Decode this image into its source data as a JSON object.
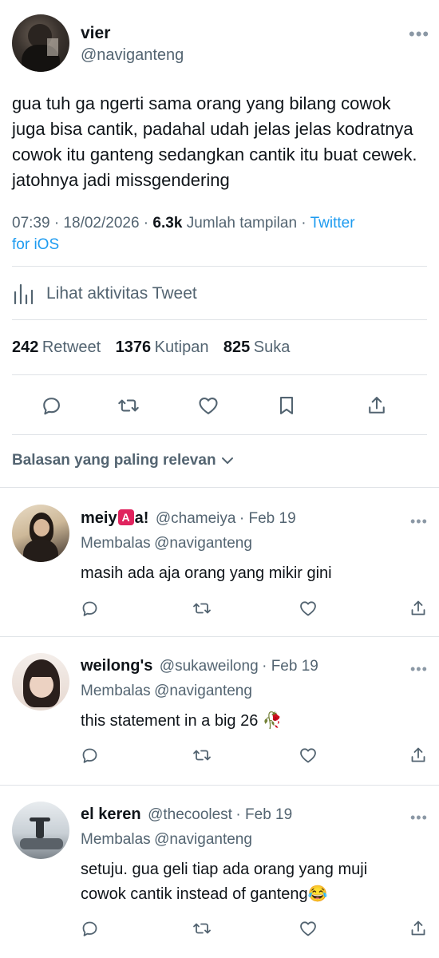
{
  "main_tweet": {
    "display_name": "vier",
    "handle": "@naviganteng",
    "more_label": "•••",
    "text": "gua tuh ga ngerti sama orang yang bilang cowok juga bisa cantik, padahal udah jelas jelas kodratnya cowok itu ganteng sedangkan cantik itu buat cewek. jatohnya jadi missgendering",
    "time": "07:39 · 18/02/2026 · ",
    "views_count": "6.3k",
    "views_label": "Jumlah tampilan",
    "separator": " · ",
    "source": "Twitter",
    "source_line2": "for iOS",
    "activity_label": "Lihat aktivitas Tweet",
    "stats": {
      "retweets": "242",
      "retweets_label": "Retweet",
      "quotes": "1376",
      "quotes_label": "Kutipan",
      "likes": "825",
      "likes_label": "Suka"
    }
  },
  "sort": {
    "label": "Balasan yang paling relevan"
  },
  "replies": [
    {
      "display_name_a": "meiy",
      "badge": "A",
      "display_name_b": "a!",
      "handle": "@chameiya",
      "date": "· Feb 19",
      "reply_prefix": "Membalas",
      "reply_to": "@naviganteng",
      "text": "masih ada aja orang yang mikir gini",
      "more_label": "•••"
    },
    {
      "display_name": "weilong's",
      "handle": "@sukaweilong",
      "date": "· Feb 19",
      "reply_prefix": "Membalas",
      "reply_to": "@naviganteng",
      "text": "this statement in a big 26 🥀",
      "more_label": "•••"
    },
    {
      "display_name": "el keren",
      "handle": "@thecoolest",
      "date": "· Feb 19",
      "reply_prefix": "Membalas",
      "reply_to": "@naviganteng",
      "text_line1": "setuju. gua geli tiap ada orang yang muji",
      "text_line2": "cowok cantik instead of ganteng😂",
      "more_label": "•••"
    }
  ],
  "colors": {
    "link": "#1d9bf0",
    "secondary": "#536471",
    "divider": "#dfe3e7",
    "badge": "#e0245e"
  },
  "icons": [
    "reply-icon",
    "retweet-icon",
    "like-icon",
    "bookmark-icon",
    "share-icon",
    "analytics-icon",
    "chevron-down-icon",
    "more-icon"
  ]
}
